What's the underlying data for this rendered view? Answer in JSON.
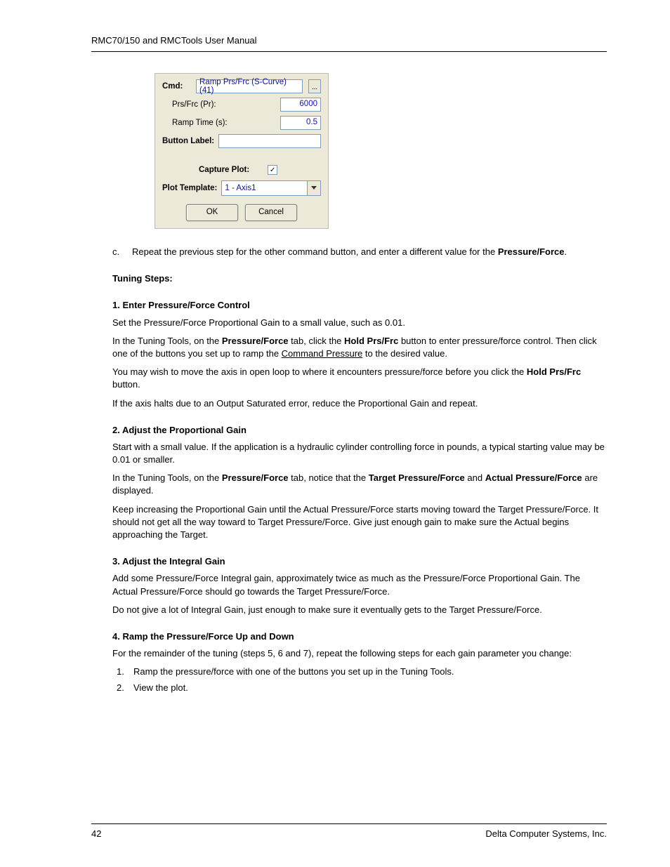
{
  "header": "RMC70/150 and RMCTools User Manual",
  "dialog": {
    "cmdLabel": "Cmd:",
    "cmdValue": "Ramp Prs/Frc (S-Curve) (41)",
    "ellipsis": "...",
    "prsLabel": "Prs/Frc (Pr):",
    "prsValue": "6000",
    "rampLabel": "Ramp Time (s):",
    "rampValue": "0.5",
    "buttonLabelLabel": "Button Label:",
    "capturePlotLabel": "Capture Plot:",
    "captureChecked": "✓",
    "plotTemplateLabel": "Plot Template:",
    "plotTemplateValue": "1 - Axis1",
    "ok": "OK",
    "cancel": "Cancel"
  },
  "stepC": {
    "marker": "c.",
    "text_a": "Repeat the previous step for the other command button, and enter a different value for the ",
    "text_b": "Pressure/Force",
    "text_c": "."
  },
  "tuning": {
    "title": "Tuning Steps:",
    "s1": {
      "title": "1. Enter Pressure/Force Control",
      "p1": "Set the Pressure/Force Proportional Gain to a small value, such as 0.01.",
      "p2a": "In the Tuning Tools, on the ",
      "p2b": "Pressure/Force",
      "p2c": " tab, click the ",
      "p2d": "Hold Prs/Frc",
      "p2e": " button to enter pressure/force control. Then click one of the buttons you set up to ramp the ",
      "p2f": "Command Pressure",
      "p2g": " to the desired value.",
      "p3a": "You may wish to move the axis in open loop to where it encounters pressure/force before you click the ",
      "p3b": "Hold Prs/Frc",
      "p3c": " button.",
      "p4": "If the axis halts due to an Output Saturated error, reduce the Proportional Gain and repeat."
    },
    "s2": {
      "title": "2. Adjust the Proportional Gain",
      "p1": "Start with a small value. If the application is a hydraulic cylinder controlling force in pounds, a typical starting value may be 0.01 or smaller.",
      "p2a": "In the Tuning Tools, on the ",
      "p2b": "Pressure/Force",
      "p2c": " tab, notice that the ",
      "p2d": "Target Pressure/Force",
      "p2e": " and ",
      "p2f": "Actual Pressure/Force",
      "p2g": " are displayed.",
      "p3": "Keep increasing the Proportional Gain until the Actual Pressure/Force starts moving toward the Target Pressure/Force. It should not get all the way toward to Target Pressure/Force. Give just enough gain to make sure the Actual begins approaching the Target."
    },
    "s3": {
      "title": "3. Adjust the Integral Gain",
      "p1": "Add some Pressure/Force Integral gain, approximately twice as much as the Pressure/Force Proportional Gain. The Actual Pressure/Force should go towards the Target Pressure/Force.",
      "p2": "Do not give a lot of Integral Gain, just enough to make sure it eventually gets to the Target Pressure/Force."
    },
    "s4": {
      "title": "4. Ramp the Pressure/Force Up and Down",
      "p1": "For the remainder of the tuning (steps 5, 6 and 7), repeat the following steps for each gain parameter you change:",
      "li1n": "1.",
      "li1": "Ramp the pressure/force with one of the buttons you set up in the Tuning Tools.",
      "li2n": "2.",
      "li2": "View the plot."
    }
  },
  "footer": {
    "pageNum": "42",
    "company": "Delta Computer Systems, Inc."
  }
}
